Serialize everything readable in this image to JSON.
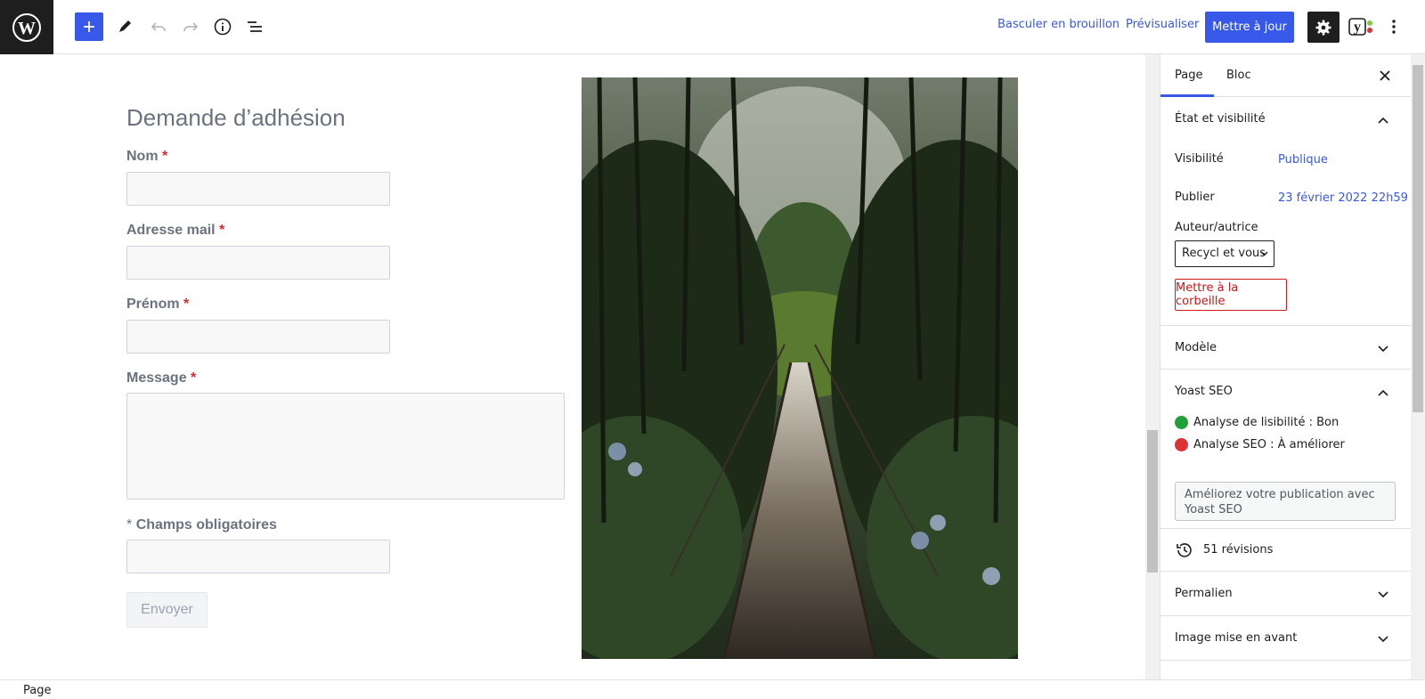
{
  "toolbar": {
    "draft_label": "Basculer en brouillon",
    "preview_label": "Prévisualiser",
    "update_label": "Mettre à jour",
    "yoast_letter": "y"
  },
  "form": {
    "title": "Demande d’adhésion",
    "fields": [
      {
        "label": "Nom",
        "required": "*"
      },
      {
        "label": "Adresse mail",
        "required": "*"
      },
      {
        "label": "Prénom",
        "required": "*"
      },
      {
        "label": "Message",
        "required": "*"
      }
    ],
    "required_note_star": "*",
    "required_note": "Champs obligatoires",
    "submit_label": "Envoyer"
  },
  "sidebar": {
    "tabs": [
      "Page",
      "Bloc"
    ],
    "status_panel": {
      "title": "État et visibilité",
      "visibility_label": "Visibilité",
      "visibility_value": "Publique",
      "publish_label": "Publier",
      "publish_value": "23 février 2022 22h59",
      "author_label": "Auteur/autrice",
      "author_value": "Recycl et vous",
      "trash_label": "Mettre à la corbeille"
    },
    "template_panel": "Modèle",
    "yoast_panel": {
      "title": "Yoast SEO",
      "readability_prefix": "Analyse de lisibilité : ",
      "readability_value": "Bon",
      "seo_prefix": "Analyse SEO : ",
      "seo_value": "À améliorer",
      "cta": "Améliorez votre publication avec Yoast SEO"
    },
    "revisions": "51 révisions",
    "permalink_panel": "Permalien",
    "featured_image_panel": "Image mise en avant"
  },
  "footer": {
    "breadcrumb": "Page"
  },
  "colors": {
    "accent": "#3858e9",
    "danger": "#cc1818",
    "good": "#22a03b",
    "bad": "#dc3232"
  }
}
